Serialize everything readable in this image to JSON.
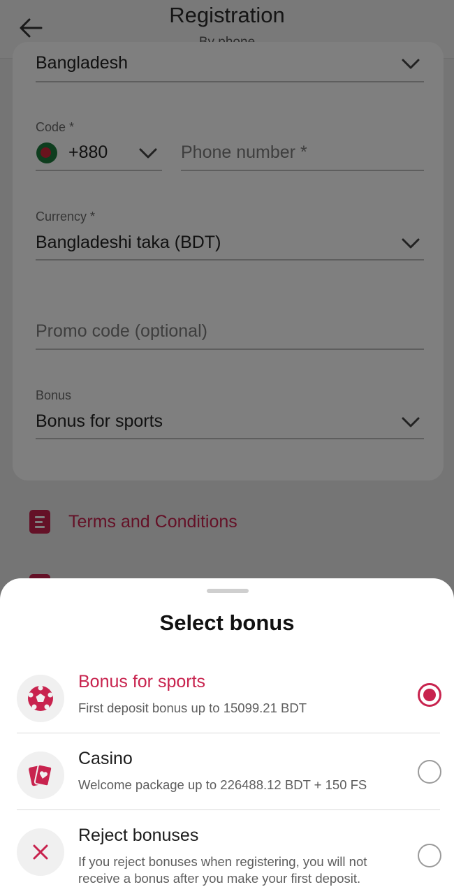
{
  "header": {
    "title": "Registration",
    "subtitle": "By phone"
  },
  "form": {
    "country_value": "Bangladesh",
    "code_label": "Code *",
    "code_value": "+880",
    "phone_placeholder": "Phone number *",
    "currency_label": "Currency *",
    "currency_value": "Bangladeshi taka (BDT)",
    "promo_placeholder": "Promo code (optional)",
    "bonus_label": "Bonus",
    "bonus_value": "Bonus for sports"
  },
  "links": {
    "terms": "Terms and Conditions"
  },
  "sheet": {
    "title": "Select bonus",
    "options": [
      {
        "title": "Bonus for sports",
        "desc": "First deposit bonus up to 15099.21 BDT",
        "icon": "soccer-ball-icon",
        "selected": true
      },
      {
        "title": "Casino",
        "desc": "Welcome package up to 226488.12 BDT + 150 FS",
        "icon": "playing-cards-icon",
        "selected": false
      },
      {
        "title": "Reject bonuses",
        "desc": "If you reject bonuses when registering, you will not receive a bonus after you make your first deposit.",
        "icon": "close-icon",
        "selected": false
      }
    ]
  },
  "colors": {
    "accent": "#c8234e",
    "overlay": "rgba(0,0,0,0.5)"
  }
}
